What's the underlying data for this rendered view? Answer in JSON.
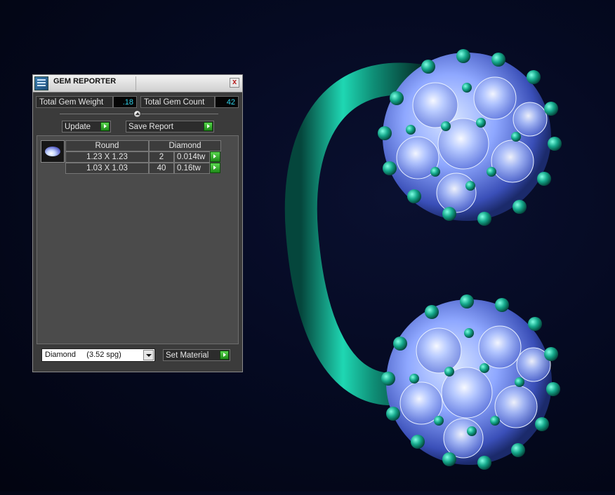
{
  "panel": {
    "title": "GEM REPORTER",
    "close_glyph": "x",
    "total_weight_label": "Total Gem Weight",
    "total_weight_value": ".18",
    "total_count_label": "Total Gem Count",
    "total_count_value": "42",
    "update_label": "Update",
    "save_report_label": "Save Report",
    "table": {
      "shape_header": "Round",
      "material_header": "Diamond",
      "rows": [
        {
          "size": "1.23 X 1.23",
          "count": "2",
          "weight": "0.014tw"
        },
        {
          "size": "1.03 X 1.03",
          "count": "40",
          "weight": "0.16tw"
        }
      ]
    },
    "material_selected": "Diamond     (3.52 spg)",
    "set_material_label": "Set Material"
  },
  "colors": {
    "viewport_bg": "#050a22",
    "metal": "#13a98e",
    "gem": "#7a9cff",
    "value_text": "#2fd1e8",
    "go_button": "#3cb534"
  },
  "icons": [
    "gem-reporter-app-icon",
    "close-icon",
    "splitter-handle-icon",
    "go-arrow-icon",
    "dropdown-arrow-icon",
    "round-gem-thumbnail"
  ]
}
